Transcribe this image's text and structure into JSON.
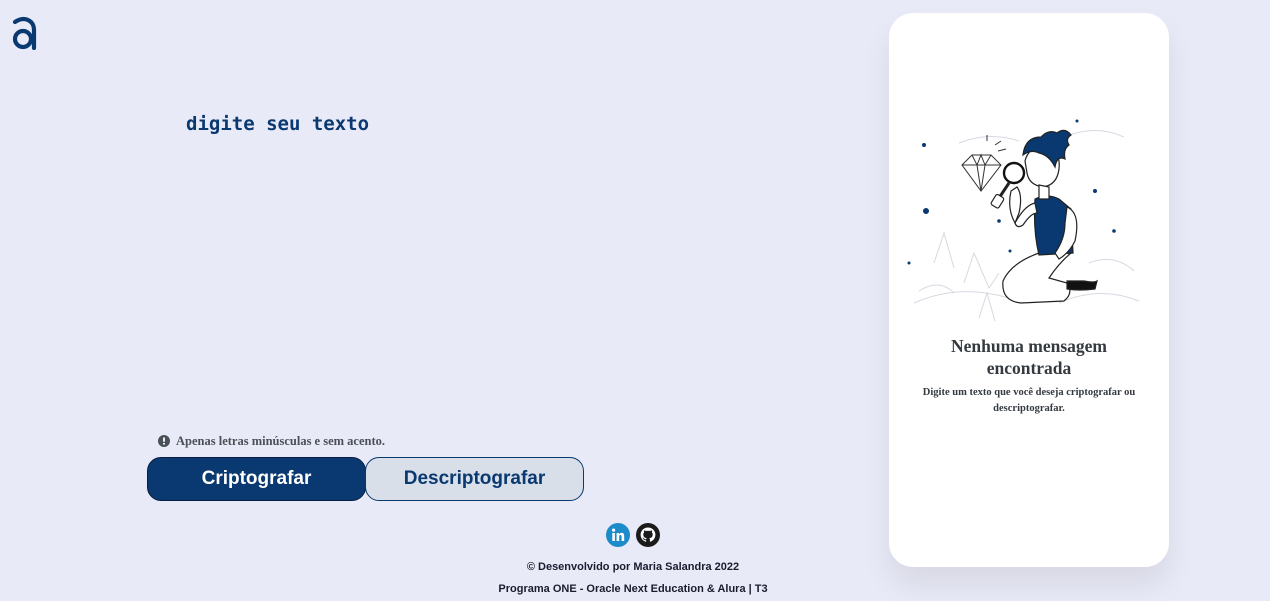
{
  "brand": {
    "logo_icon": "alura-a-logo-icon",
    "accent": "#0a3871"
  },
  "input": {
    "placeholder": "digite seu texto",
    "value": ""
  },
  "hint": {
    "icon": "exclamation-circle-icon",
    "text": "Apenas letras minúsculas e sem acento."
  },
  "buttons": {
    "encrypt_label": "Criptografar",
    "decrypt_label": "Descriptografar"
  },
  "social": {
    "linkedin_icon": "linkedin-icon",
    "github_icon": "github-icon"
  },
  "footer": {
    "credit": "© Desenvolvido por Maria Salandra 2022",
    "program": "Programa ONE - Oracle Next Education & Alura | T3"
  },
  "output": {
    "illustration": "boy-with-magnifier-illustration",
    "title": "Nenhuma mensagem encontrada",
    "description": "Digite um texto que você deseja criptografar ou descriptografar."
  }
}
